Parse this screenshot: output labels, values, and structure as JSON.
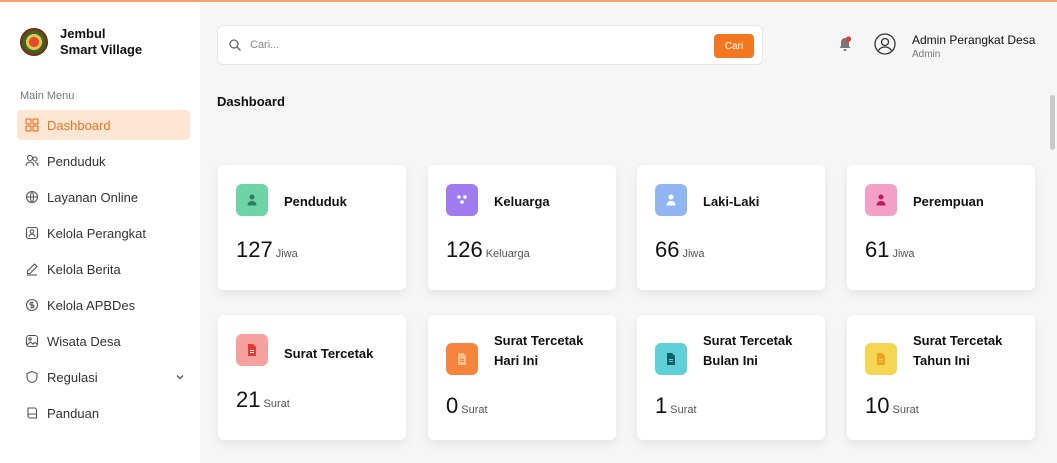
{
  "brand": {
    "line1": "Jembul",
    "line2": "Smart Village"
  },
  "sidebar": {
    "menu_title": "Main Menu",
    "items": [
      {
        "label": "Dashboard",
        "icon": "grid-icon",
        "active": true
      },
      {
        "label": "Penduduk",
        "icon": "users-icon"
      },
      {
        "label": "Layanan Online",
        "icon": "globe-icon"
      },
      {
        "label": "Kelola Perangkat",
        "icon": "id-card-icon"
      },
      {
        "label": "Kelola Berita",
        "icon": "edit-icon"
      },
      {
        "label": "Kelola APBDes",
        "icon": "money-icon"
      },
      {
        "label": "Wisata Desa",
        "icon": "image-icon"
      },
      {
        "label": "Regulasi",
        "icon": "shield-icon",
        "has_chevron": true
      },
      {
        "label": "Panduan",
        "icon": "book-icon"
      }
    ]
  },
  "search": {
    "placeholder": "Cari...",
    "button_label": "Cari"
  },
  "user": {
    "name": "Admin Perangkat Desa",
    "role": "Admin"
  },
  "page": {
    "title": "Dashboard"
  },
  "cards": [
    {
      "label": "Penduduk",
      "value": "127",
      "unit": "Jiwa",
      "color": "#6fd3a8"
    },
    {
      "label": "Keluarga",
      "value": "126",
      "unit": "Keluarga",
      "color": "#a07cf0"
    },
    {
      "label": "Laki-Laki",
      "value": "66",
      "unit": "Jiwa",
      "color": "#8fb6f0"
    },
    {
      "label": "Perempuan",
      "value": "61",
      "unit": "Jiwa",
      "color": "#f2a0c8"
    },
    {
      "label": "Surat Tercetak",
      "value": "21",
      "unit": "Surat",
      "color": "#f6a0a0"
    },
    {
      "label_line1": "Surat Tercetak",
      "label_line2": "Hari Ini",
      "value": "0",
      "unit": "Surat",
      "color": "#f7843d"
    },
    {
      "label_line1": "Surat Tercetak",
      "label_line2": "Bulan Ini",
      "value": "1",
      "unit": "Surat",
      "color": "#5fd0d8"
    },
    {
      "label_line1": "Surat Tercetak",
      "label_line2": "Tahun Ini",
      "value": "10",
      "unit": "Surat",
      "color": "#f5d652"
    }
  ],
  "colors": {
    "accent": "#f37720",
    "active_bg": "#fde6d3"
  }
}
